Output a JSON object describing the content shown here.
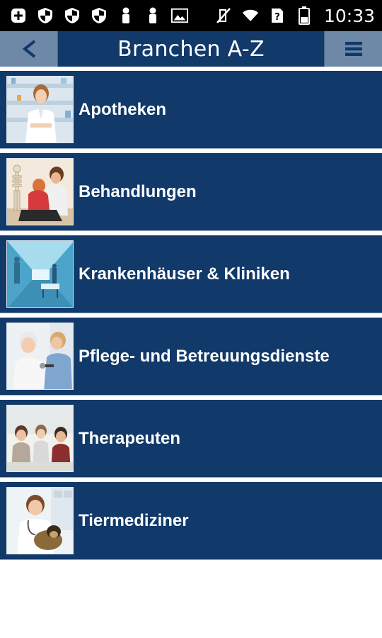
{
  "status_bar": {
    "time": "10:33",
    "icons_left": [
      "plus-icon",
      "shield-icon",
      "shield-icon",
      "shield-icon",
      "person-icon",
      "person-icon",
      "image-icon"
    ],
    "icons_right": [
      "mute-icon",
      "wifi-icon",
      "unknown-sim-icon",
      "battery-icon"
    ]
  },
  "header": {
    "title": "Branchen A-Z",
    "back_label": "<",
    "colors": {
      "bar": "#11396a",
      "button": "#6e88a8"
    }
  },
  "categories": [
    {
      "label": "Apotheken",
      "image": "pharmacist-photo"
    },
    {
      "label": "Behandlungen",
      "image": "physiotherapy-photo"
    },
    {
      "label": "Krankenhäuser & Kliniken",
      "image": "hospital-corridor-photo"
    },
    {
      "label": "Pflege- und Betreuungsdienste",
      "image": "elderly-care-photo"
    },
    {
      "label": "Therapeuten",
      "image": "group-therapy-photo"
    },
    {
      "label": "Tiermediziner",
      "image": "veterinarian-photo"
    }
  ]
}
